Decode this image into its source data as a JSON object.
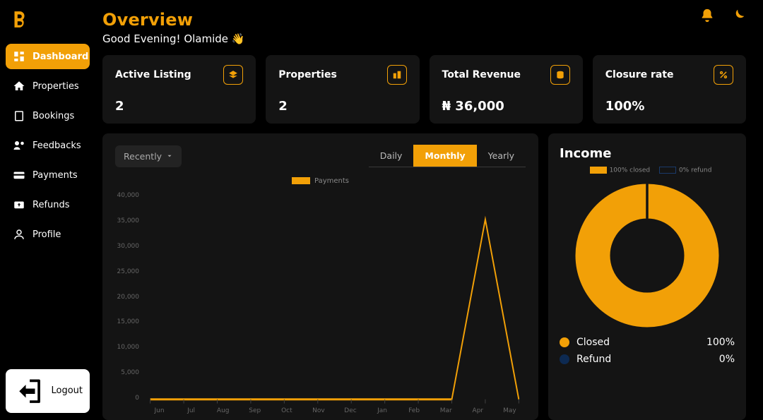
{
  "header": {
    "title": "Overview",
    "greeting": "Good Evening! Olamide 👋"
  },
  "sidebar": {
    "items": [
      {
        "label": "Dashboard",
        "icon": "dashboard",
        "active": true
      },
      {
        "label": "Properties",
        "icon": "home"
      },
      {
        "label": "Bookings",
        "icon": "book"
      },
      {
        "label": "Feedbacks",
        "icon": "feedback"
      },
      {
        "label": "Payments",
        "icon": "card"
      },
      {
        "label": "Refunds",
        "icon": "refund"
      },
      {
        "label": "Profile",
        "icon": "user"
      }
    ],
    "logout": "Logout"
  },
  "cards": [
    {
      "label": "Active Listing",
      "value": "2",
      "icon": "layers"
    },
    {
      "label": "Properties",
      "value": "2",
      "icon": "buildings"
    },
    {
      "label": "Total Revenue",
      "value": "₦ 36,000",
      "icon": "money"
    },
    {
      "label": "Closure rate",
      "value": "100%",
      "icon": "percent"
    }
  ],
  "chart": {
    "dropdown": "Recently",
    "tabs": {
      "daily": "Daily",
      "monthly": "Monthly",
      "yearly": "Yearly"
    },
    "legend_label": "Payments"
  },
  "chart_data": {
    "type": "line",
    "categories": [
      "Jun",
      "Jul",
      "Aug",
      "Sep",
      "Oct",
      "Nov",
      "Dec",
      "Jan",
      "Feb",
      "Mar",
      "Apr",
      "May"
    ],
    "series": [
      {
        "name": "Payments",
        "values": [
          0,
          0,
          0,
          0,
          0,
          0,
          0,
          0,
          0,
          0,
          36000,
          0
        ]
      }
    ],
    "ylabel": "",
    "ylim": [
      0,
      40000
    ],
    "yticks": [
      40000,
      35000,
      30000,
      25000,
      20000,
      15000,
      10000,
      5000,
      0
    ]
  },
  "income": {
    "title": "Income",
    "legend": {
      "closed": "100% closed",
      "refund": "0% refund"
    },
    "rows": [
      {
        "label": "Closed",
        "value": "100%",
        "color": "#f2a007"
      },
      {
        "label": "Refund",
        "value": "0%",
        "color": "#0d2a52"
      }
    ],
    "donut": {
      "closed": 100,
      "refund": 0
    }
  },
  "colors": {
    "accent": "#f2a007",
    "dark": "#141414",
    "refund": "#0d2a52"
  }
}
